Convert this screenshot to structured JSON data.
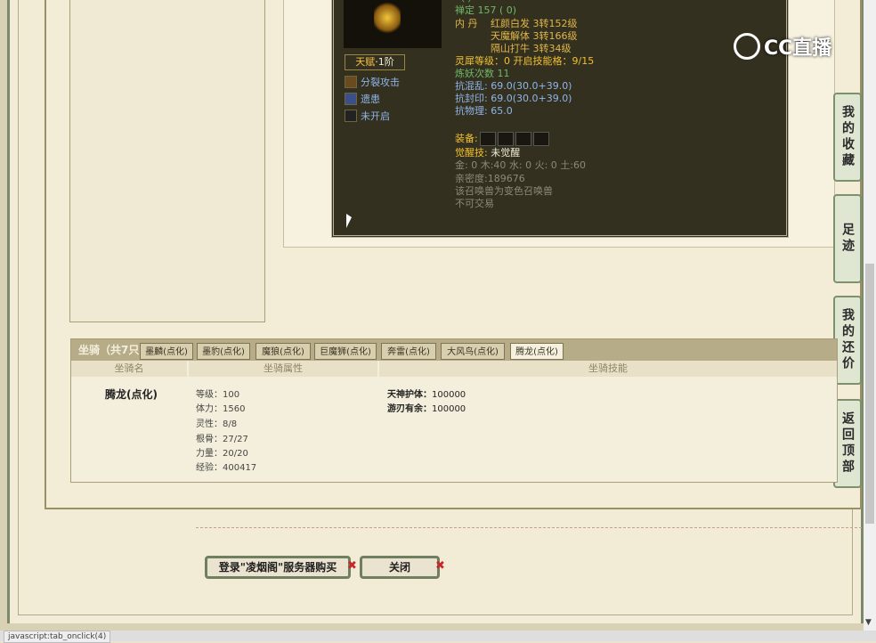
{
  "tooltip": {
    "partial_top": "（ ）",
    "chanding": "禅定 157 ( 0)",
    "neidan_label": "内 丹",
    "neidan": [
      "红颜白发 3转152级",
      "天魔解体 3转166级",
      "隔山打牛 3转34级"
    ],
    "lingxi": "灵犀等级：0 开启技能格：9/15",
    "lianyao": "炼妖次数 11",
    "kanghunluan": "抗混乱: 69.0(30.0+39.0)",
    "kangfengyin": "抗封印: 69.0(30.0+39.0)",
    "kangwuli": "抗物理: 65.0",
    "equip_label": "装备:",
    "juexing_label": "觉醒技:",
    "juexing_value": "未觉醒",
    "wuxing": "金: 0 木:40 水: 0 火: 0 土:60",
    "qinmi": "亲密度:189676",
    "bianse": "该召唤兽为变色召唤兽",
    "trade": "不可交易"
  },
  "talent": {
    "label": "天赋",
    "level": "·1阶"
  },
  "skills": [
    {
      "name": "分裂攻击",
      "icon": "split-attack-icon"
    },
    {
      "name": "遗患",
      "icon": "yihuan-icon"
    },
    {
      "name": "未开启",
      "icon": "locked-slot-icon"
    }
  ],
  "side_tabs": [
    "我的收藏",
    "足迹",
    "我的还价",
    "返回顶部"
  ],
  "logo": {
    "text": "CC直播"
  },
  "mount": {
    "title": "坐骑（共7只",
    "tabs": [
      "墨麟(点化)",
      "墨豹(点化)",
      "魔狼(点化)",
      "巨魔狮(点化)",
      "奔雷(点化)",
      "大风鸟(点化)",
      "腾龙(点化)"
    ],
    "active_tab": "腾龙(点化)",
    "columns": [
      "坐骑名",
      "坐骑属性",
      "坐骑技能"
    ],
    "name": "腾龙(点化)",
    "stats": [
      "等级：100",
      "体力：1560",
      "灵性：8/8",
      "根骨：27/27",
      "力量：20/20",
      "经验：400417"
    ],
    "skills": [
      {
        "name": "天神护体：",
        "value": "100000"
      },
      {
        "name": "游刃有余：",
        "value": "100000"
      }
    ]
  },
  "buttons": {
    "buy": "登录\"凌烟阁\"服务器购买",
    "close": "关闭"
  },
  "status": "javascript:tab_onclick(4)",
  "colors": {
    "frame_green": "#7a8a6a",
    "tooltip_bg": "#34301f",
    "gold": "#e0b64a",
    "blue": "#8fb5ea"
  }
}
